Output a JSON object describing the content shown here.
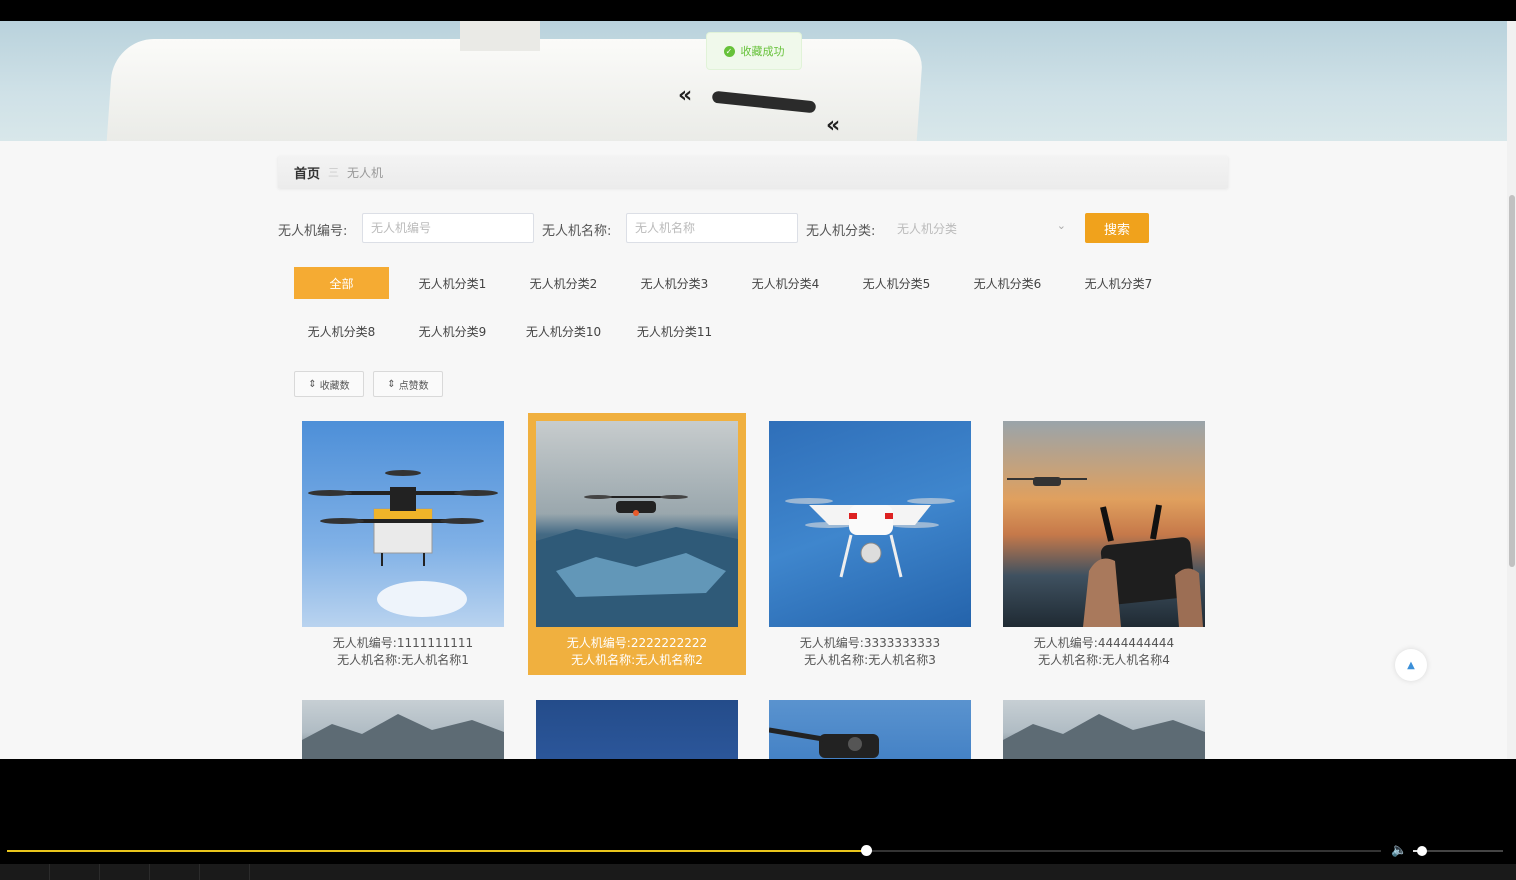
{
  "toast": {
    "icon": "check-circle-icon",
    "text": "收藏成功"
  },
  "breadcrumb": {
    "home": "首页",
    "separator": "三",
    "current": "无人机"
  },
  "search": {
    "code_label": "无人机编号:",
    "code_placeholder": "无人机编号",
    "name_label": "无人机名称:",
    "name_placeholder": "无人机名称",
    "category_label": "无人机分类:",
    "category_placeholder": "无人机分类",
    "search_button": "搜索"
  },
  "categories": [
    "全部",
    "无人机分类1",
    "无人机分类2",
    "无人机分类3",
    "无人机分类4",
    "无人机分类5",
    "无人机分类6",
    "无人机分类7",
    "无人机分类8",
    "无人机分类9",
    "无人机分类10",
    "无人机分类11"
  ],
  "active_category": "全部",
  "sort": {
    "favorites": "收藏数",
    "likes": "点赞数",
    "icon": "sort-arrows-icon"
  },
  "cards": [
    {
      "code_label": "无人机编号:",
      "code": "1111111111",
      "name_label": "无人机名称:",
      "name": "无人机名称1"
    },
    {
      "code_label": "无人机编号:",
      "code": "2222222222",
      "name_label": "无人机名称:",
      "name": "无人机名称2"
    },
    {
      "code_label": "无人机编号:",
      "code": "3333333333",
      "name_label": "无人机名称:",
      "name": "无人机名称3"
    },
    {
      "code_label": "无人机编号:",
      "code": "4444444444",
      "name_label": "无人机名称:",
      "name": "无人机名称4"
    }
  ],
  "player": {
    "progress": 0.625,
    "volume": 0.1
  },
  "colors": {
    "accent": "#f0a21c",
    "tab_active": "#f5ab33",
    "success": "#67c23a"
  }
}
